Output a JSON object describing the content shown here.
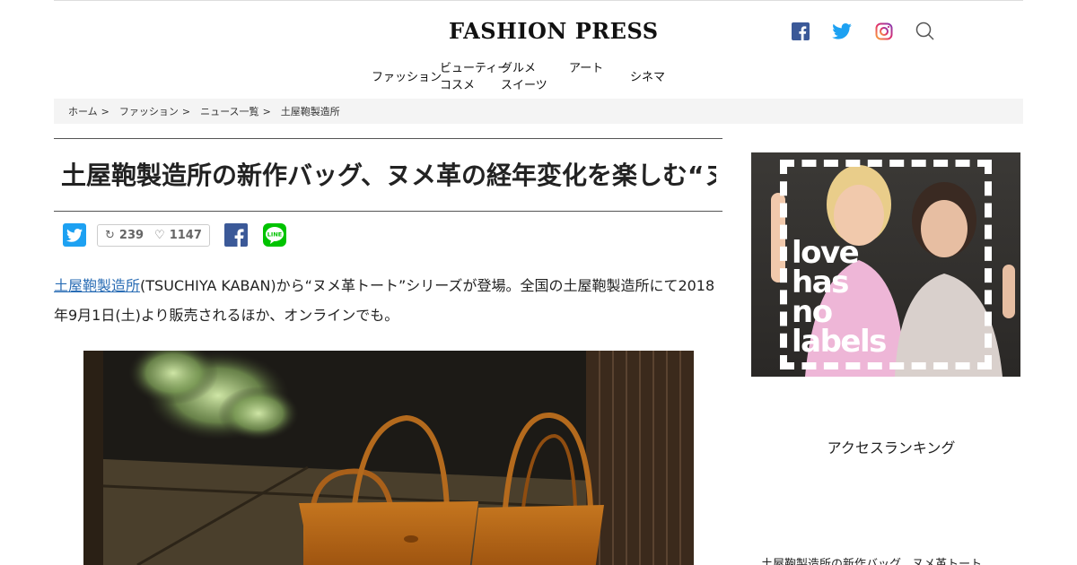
{
  "brand": {
    "name": "FASHION PRESS",
    "colors": {
      "facebook": "#3b5998",
      "twitter": "#1da1f2",
      "line": "#00c300",
      "link": "#2a6db5"
    }
  },
  "header": {
    "social": [
      {
        "icon": "facebook-icon"
      },
      {
        "icon": "twitter-icon"
      },
      {
        "icon": "instagram-icon"
      },
      {
        "icon": "search-icon"
      }
    ],
    "nav": [
      {
        "lines": [
          "ファッション",
          ""
        ]
      },
      {
        "lines": [
          "ビューティー",
          "コスメ"
        ]
      },
      {
        "lines": [
          "グルメ",
          "スイーツ"
        ]
      },
      {
        "lines": [
          "アート",
          ""
        ]
      },
      {
        "lines": [
          "シネマ",
          ""
        ]
      }
    ]
  },
  "breadcrumb": [
    {
      "label": "ホーム",
      "sep": ">"
    },
    {
      "label": "ファッション",
      "sep": ">"
    },
    {
      "label": "ニュース一覧",
      "sep": ">"
    },
    {
      "label": "土屋鞄製造所",
      "sep": ""
    }
  ],
  "article": {
    "title": "土屋鞄製造所の新作バッグ、ヌメ革の経年変化を楽しむ“ヌメ革トート”シリーズ",
    "share": {
      "retweet_count": "239",
      "like_count": "1147"
    },
    "lead": {
      "link_text": "土屋鞄製造所",
      "text": "(TSUCHIYA KABAN)から“ヌメ革トート”シリーズが登場。全国の土屋鞄製造所にて2018年9月1日(土)より販売されるほか、オンラインでも。"
    },
    "image_alt": "土屋鞄製造所 ヌメ革トート"
  },
  "sidebar": {
    "ad": {
      "lines": [
        "love",
        "has",
        "no",
        "labels"
      ]
    },
    "title": "アクセスランキング",
    "first_item": "土屋鞄製造所の新作バッグ、ヌメ革トート"
  }
}
